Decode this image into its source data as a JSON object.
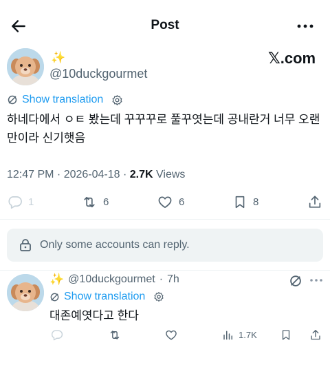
{
  "header": {
    "title": "Post"
  },
  "post": {
    "display_name": "✨",
    "handle": "@10duckgourmet",
    "watermark": "𝕏.com",
    "translate_label": "Show translation",
    "text": "하네다에서 ㅇㅌ 봤는데 꾸꾸꾸로 풀꾸엿는데 공내란거 너무 오랜만이라 신기햇음",
    "time": "12:47 PM",
    "date": "2026-04-18",
    "views_count": "2.7K",
    "views_label": "Views",
    "actions": {
      "replies": "1",
      "reposts": "6",
      "likes": "6",
      "bookmarks": "8"
    }
  },
  "reply_restriction": "Only some accounts can reply.",
  "reply": {
    "display_name": "✨",
    "handle": "@10duckgourmet",
    "age": "7h",
    "translate_label": "Show translation",
    "text": "대존예엿다고 한다",
    "views": "1.7K"
  },
  "colors": {
    "accent": "#1d9bf0",
    "muted": "#536471",
    "text": "#0f1419",
    "reply_bg": "#eff3f4"
  },
  "icons": [
    "back-arrow-icon",
    "more-horizontal-icon",
    "translate-icon",
    "gear-icon",
    "reply-icon",
    "repost-icon",
    "like-icon",
    "bookmark-icon",
    "share-icon",
    "lock-icon",
    "grok-icon",
    "views-icon"
  ]
}
